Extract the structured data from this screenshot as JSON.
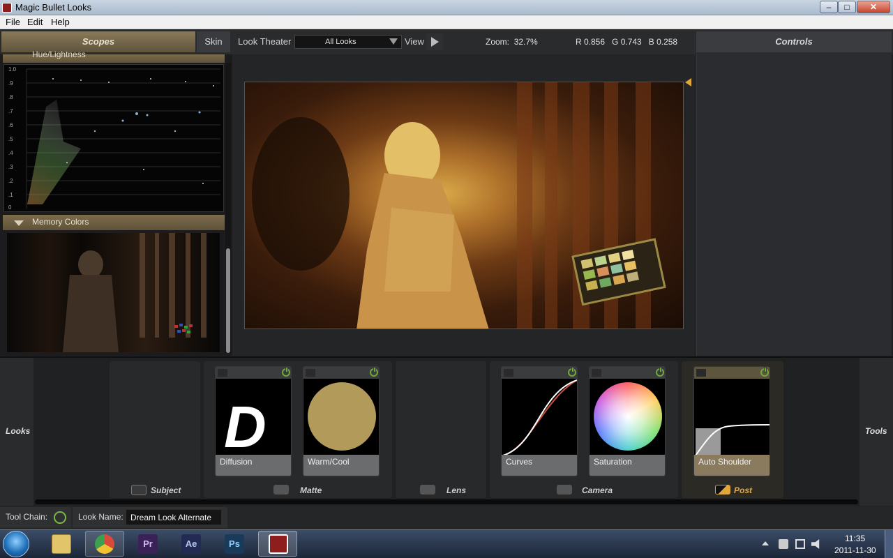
{
  "window": {
    "title": "Magic Bullet Looks",
    "minimize": "–",
    "maximize": "□",
    "close": "✕"
  },
  "menu": [
    "File",
    "Edit",
    "Help"
  ],
  "header": {
    "scopes_tab": "Scopes",
    "skin_tab": "Skin",
    "look_theater_label": "Look Theater",
    "looks_filter": "All Looks",
    "view_label": "View",
    "zoom_label": "Zoom:",
    "zoom_value": "32.7%",
    "rgb": "R 0.856   G 0.743   B 0.258",
    "controls_tab": "Controls"
  },
  "scopes": {
    "hue_header": "Hue/Lightness",
    "y_labels": [
      "1.0",
      ".9",
      ".8",
      ".7",
      ".6",
      ".5",
      ".4",
      ".3",
      ".2",
      ".1",
      "0"
    ],
    "memory_colors_label": "Memory Colors"
  },
  "toolchain": {
    "side_left": "Looks",
    "side_right": "Tools",
    "groups": [
      "Subject",
      "Matte",
      "Lens",
      "Camera",
      "Post"
    ],
    "cards": [
      "Diffusion",
      "Warm/Cool",
      "Curves",
      "Saturation",
      "Auto Shoulder"
    ],
    "diffusion_glyph": "D"
  },
  "status": {
    "tool_chain_label": "Tool Chain:",
    "look_name_label": "Look Name:",
    "look_name_value": "Dream Look Alternate"
  },
  "taskbar": {
    "apps": [
      "Pr",
      "Ae",
      "Ps"
    ],
    "time": "11:35",
    "date": "2011-11-30"
  },
  "colors": {
    "accent_gold": "#e2a73a",
    "power_green": "#6fa83c",
    "warm_cool_swatch": "#b29a5a"
  }
}
